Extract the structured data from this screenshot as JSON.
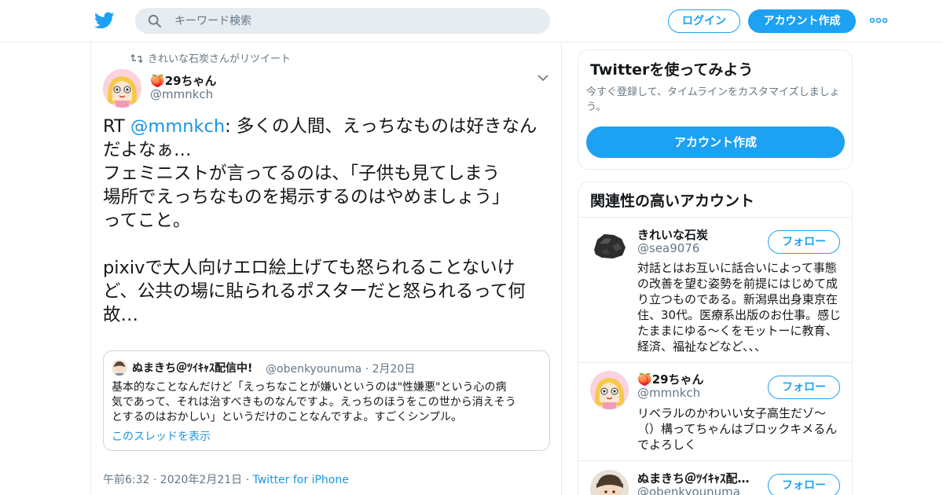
{
  "header": {
    "search_placeholder": "キーワード検索",
    "login_label": "ログイン",
    "signup_label": "アカウント作成",
    "icons": {
      "logo": "twitter-bird-icon",
      "search": "search-icon",
      "more": "more-dots-icon"
    },
    "brand_color": "#1da1f2"
  },
  "tweet": {
    "retweet_context": "きれいな石炭さんがリツイート",
    "author_name": "29ちゃん",
    "author_emoji": "🍑",
    "author_handle": "@mmnkch",
    "text_prefix": "RT ",
    "text_mention": "@mmnkch",
    "text_line1_rest": ": 多くの人間、えっちなものは好きなん",
    "text_lines": [
      "だよなぁ…",
      "フェミニストが言ってるのは、「子供も見てしまう",
      "場所でえっちなものを掲示するのはやめましょう」",
      "ってこと。",
      "",
      "pixivで大人向けエロ絵上げても怒られることないけ",
      "ど、公共の場に貼られるポスターだと怒られるって何",
      "故…"
    ],
    "quote": {
      "name": "ぬまきち＠ﾂｲｷｬｽ配信中!",
      "handle": "@obenkyounuma",
      "separator": "·",
      "date": "2月20日",
      "text_lines": [
        "基本的なことなんだけど「えっちなことが嫌いというのは\"性嫌悪\"という心の病",
        "気であって、それは治すべきものなんですよ。えっちのほうをこの世から消えそう",
        "とするのはおかしい」というだけのことなんですよ。すごくシンプル。"
      ],
      "thread_link": "このスレッドを表示"
    },
    "timestamp": "午前6:32 · 2020年2月21日 · ",
    "client": "Twitter for iPhone"
  },
  "sidebar": {
    "signup_card": {
      "title": "Twitterを使ってみよう",
      "desc_lines": [
        "今すぐ登録して、タイムラインをカスタマイズしましょ",
        "う。"
      ],
      "button_label": "アカウント作成"
    },
    "related": {
      "title": "関連性の高いアカウント",
      "follow_label": "フォロー",
      "accounts": [
        {
          "name": "きれいな石炭",
          "handle": "@sea9076",
          "bio_lines": [
            "対話とはお互いに話合いによって事態",
            "の改善を望む姿勢を前提にはじめて成",
            "り立つものである。新潟県出身東京在",
            "住、30代。医療系出版のお仕事。感じ",
            "たままにゆる〜くをモットーに教育、",
            "経済、福祉などなど、、、"
          ]
        },
        {
          "name": "29ちゃん",
          "emoji": "🍑",
          "handle": "@mmnkch",
          "bio_lines": [
            "リベラルのかわいい女子高生だゾ〜",
            "（）構ってちゃんはブロックキメるん",
            "でよろしく"
          ]
        },
        {
          "name": "ぬまきち＠ﾂｲｷｬｽ配…",
          "handle": "@obenkyounuma",
          "bio_lines": []
        }
      ]
    }
  }
}
